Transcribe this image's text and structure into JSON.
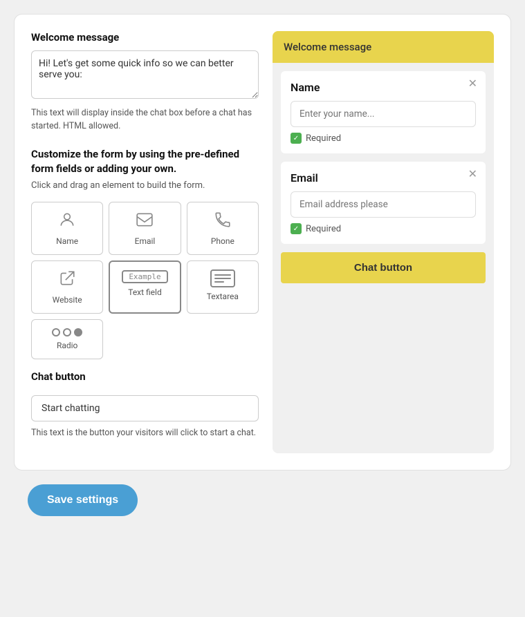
{
  "left": {
    "welcome_message": {
      "title": "Welcome message",
      "textarea_value": "Hi! Let's get some quick info so we can better serve you:",
      "hint": "This text will display inside the chat box before a chat has started. HTML allowed."
    },
    "customize": {
      "title": "Customize the form by using the pre-defined form fields or adding your own.",
      "subtitle": "Click and drag an element to build the form.",
      "fields": [
        {
          "id": "name",
          "label": "Name",
          "icon_type": "person"
        },
        {
          "id": "email",
          "label": "Email",
          "icon_type": "email"
        },
        {
          "id": "phone",
          "label": "Phone",
          "icon_type": "phone"
        },
        {
          "id": "website",
          "label": "Website",
          "icon_type": "website"
        },
        {
          "id": "textfield",
          "label": "Text field",
          "icon_type": "textfield"
        },
        {
          "id": "textarea",
          "label": "Textarea",
          "icon_type": "textarea"
        },
        {
          "id": "radio",
          "label": "Radio",
          "icon_type": "radio"
        }
      ]
    },
    "chat_button": {
      "title": "Chat button",
      "input_value": "Start chatting",
      "hint": "This text is the button your visitors will click to start a chat."
    }
  },
  "right": {
    "header": "Welcome message",
    "name_card": {
      "title": "Name",
      "placeholder": "Enter your name...",
      "required_label": "Required"
    },
    "email_card": {
      "title": "Email",
      "placeholder": "Email address please",
      "required_label": "Required"
    },
    "chat_button_label": "Chat button"
  },
  "footer": {
    "save_label": "Save settings"
  }
}
